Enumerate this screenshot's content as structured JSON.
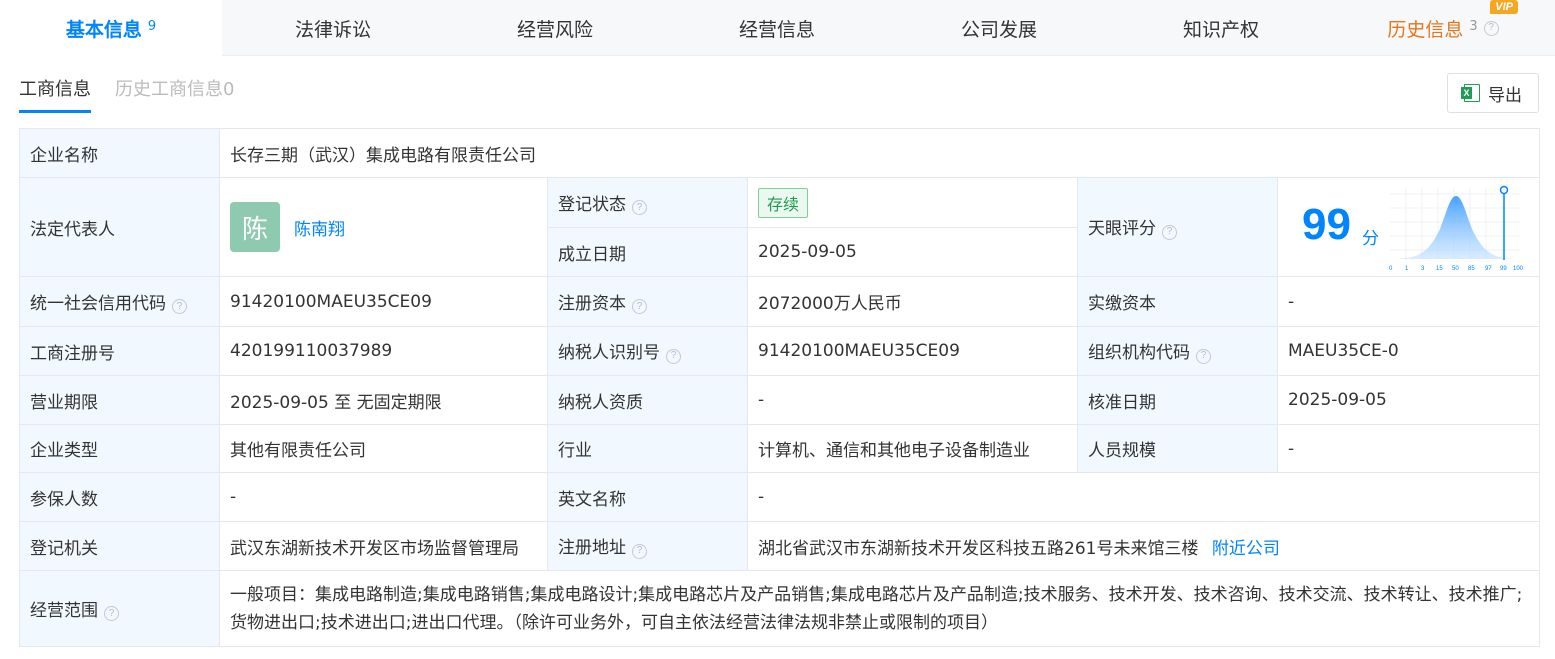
{
  "top_tabs": [
    {
      "label": "基本信息",
      "count": "9"
    },
    {
      "label": "法律诉讼"
    },
    {
      "label": "经营风险"
    },
    {
      "label": "经营信息"
    },
    {
      "label": "公司发展"
    },
    {
      "label": "知识产权"
    },
    {
      "label": "历史信息",
      "count": "3",
      "badge": "VIP"
    }
  ],
  "sub_tabs": [
    "工商信息",
    "历史工商信息0"
  ],
  "export_label": "导出",
  "table": {
    "company_name_label": "企业名称",
    "company_name": "长存三期（武汉）集成电路有限责任公司",
    "legal_rep_label": "法定代表人",
    "legal_rep_avatar": "陈",
    "legal_rep_name": "陈南翔",
    "reg_status_label": "登记状态",
    "reg_status": "存续",
    "found_date_label": "成立日期",
    "found_date": "2025-09-05",
    "tianyan_score_label": "天眼评分",
    "score": "99",
    "score_unit": "分",
    "credit_code_label": "统一社会信用代码",
    "credit_code": "91420100MAEU35CE09",
    "reg_capital_label": "注册资本",
    "reg_capital": "2072000万人民币",
    "paid_capital_label": "实缴资本",
    "paid_capital": "-",
    "biz_reg_no_label": "工商注册号",
    "biz_reg_no": "420199110037989",
    "taxpayer_id_label": "纳税人识别号",
    "taxpayer_id": "91420100MAEU35CE09",
    "org_code_label": "组织机构代码",
    "org_code": "MAEU35CE-0",
    "term_label": "营业期限",
    "term": "2025-09-05 至 无固定期限",
    "taxpayer_qual_label": "纳税人资质",
    "taxpayer_qual": "-",
    "approval_date_label": "核准日期",
    "approval_date": "2025-09-05",
    "company_type_label": "企业类型",
    "company_type": "其他有限责任公司",
    "industry_label": "行业",
    "industry": "计算机、通信和其他电子设备制造业",
    "staff_size_label": "人员规模",
    "staff_size": "-",
    "insured_label": "参保人数",
    "insured": "-",
    "english_name_label": "英文名称",
    "english_name": "-",
    "reg_authority_label": "登记机关",
    "reg_authority": "武汉东湖新技术开发区市场监督管理局",
    "reg_address_label": "注册地址",
    "reg_address": "湖北省武汉市东湖新技术开发区科技五路261号未来馆三楼",
    "nearby_label": "附近公司",
    "scope_label": "经营范围",
    "scope": "一般项目：集成电路制造;集成电路销售;集成电路设计;集成电路芯片及产品销售;集成电路芯片及产品制造;技术服务、技术开发、技术咨询、技术交流、技术转让、技术推广;货物进出口;技术进出口;进出口代理。（除许可业务外，可自主依法经营法律法规非禁止或限制的项目）"
  },
  "score_axis_ticks": [
    "0",
    "1",
    "3",
    "15",
    "50",
    "85",
    "97",
    "99",
    "100"
  ],
  "colors": {
    "accent": "#0084ff",
    "history": "#e5761c",
    "label_bg": "#f2f8ff"
  }
}
